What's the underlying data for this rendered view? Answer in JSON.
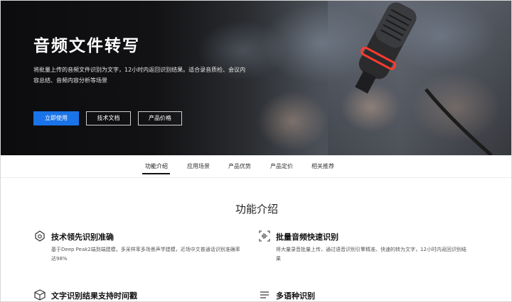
{
  "hero": {
    "title": "音频文件转写",
    "description": "将批量上传的音频文件识别为文字，12小时内返回识别结果。适合录音质检、会议内容总结、音频内容分析等场景",
    "buttons": {
      "primary": "立即使用",
      "docs": "技术文档",
      "pricing": "产品价格"
    }
  },
  "tabs": [
    {
      "label": "功能介绍"
    },
    {
      "label": "应用场景"
    },
    {
      "label": "产品优势"
    },
    {
      "label": "产品定价"
    },
    {
      "label": "相关推荐"
    }
  ],
  "section": {
    "title": "功能介绍",
    "features": [
      {
        "title": "技术领先识别准确",
        "desc": "基于Deep Peak2端到端建模，多采样率多场景声学建模，近场中文普通话识别准确率达98%",
        "icon": "target-icon"
      },
      {
        "title": "批量音频快速识别",
        "desc": "将大量录音批量上传，通过语音识别引擎精准、快速的转为文字，12小时内返回识别结果",
        "icon": "audio-wave-icon"
      },
      {
        "title": "文字识别结果支持时间戳",
        "desc": "",
        "icon": "cube-icon"
      },
      {
        "title": "多语种识别",
        "desc": "",
        "icon": "list-icon"
      }
    ]
  },
  "colors": {
    "primary": "#1a73e8",
    "mic_ring": "#ff3b2f"
  }
}
